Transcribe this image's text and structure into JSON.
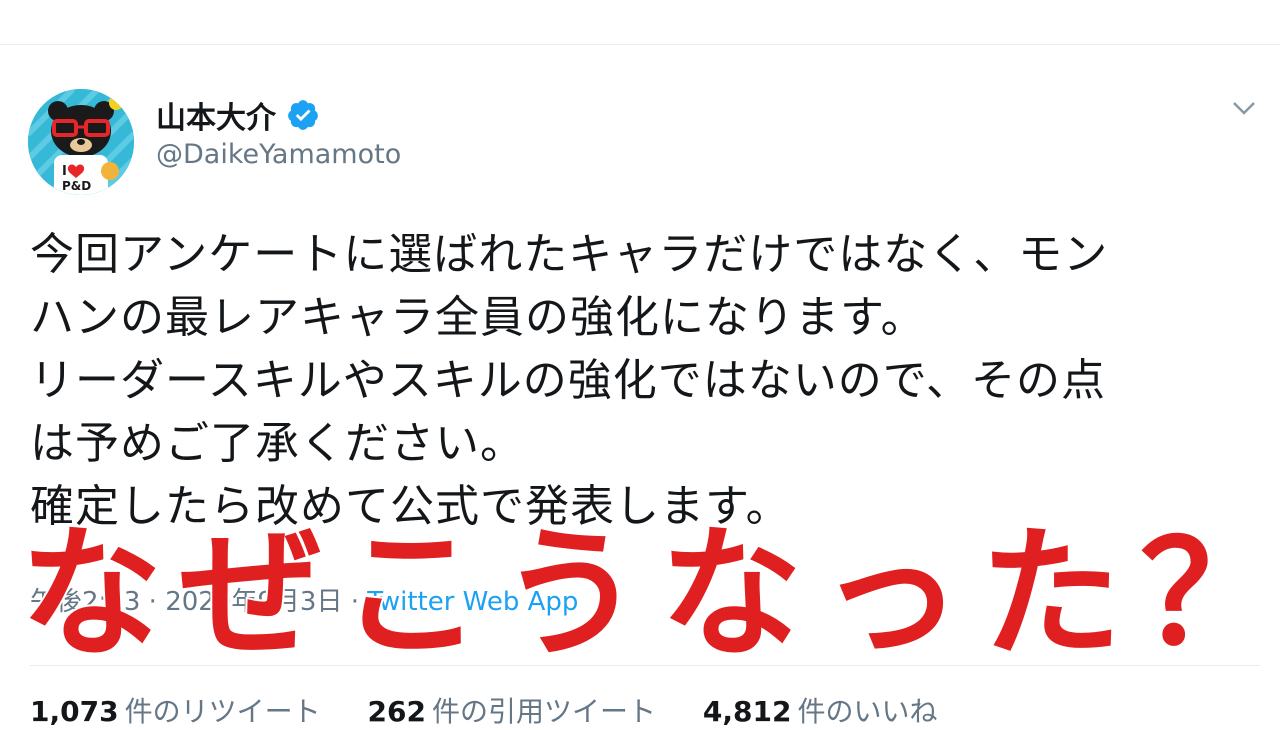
{
  "tweet": {
    "display_name": "山本大介",
    "handle": "@DaikeYamamoto",
    "body_lines": [
      "今回アンケートに選ばれたキャラだけではなく、モン",
      "ハンの最レアキャラ全員の強化になります。",
      "リーダースキルやスキルの強化ではないので、その点",
      "は予めご了承ください。",
      "確定したら改めて公式で発表します。"
    ],
    "time": "午後2:23",
    "date": "2020年9月3日",
    "separator": " · ",
    "source": "Twitter Web App",
    "stats": {
      "retweets_count": "1,073",
      "retweets_label": "件のリツイート",
      "quotes_count": "262",
      "quotes_label": "件の引用ツイート",
      "likes_count": "4,812",
      "likes_label": "件のいいね"
    }
  },
  "overlay_caption": "なぜこうなった？",
  "colors": {
    "verified": "#1da1f2",
    "link": "#1da1f2",
    "overlay": "#e02020",
    "secondary_text": "#657786"
  },
  "icons": {
    "verified": "verified-badge-icon",
    "menu": "chevron-down-icon"
  }
}
